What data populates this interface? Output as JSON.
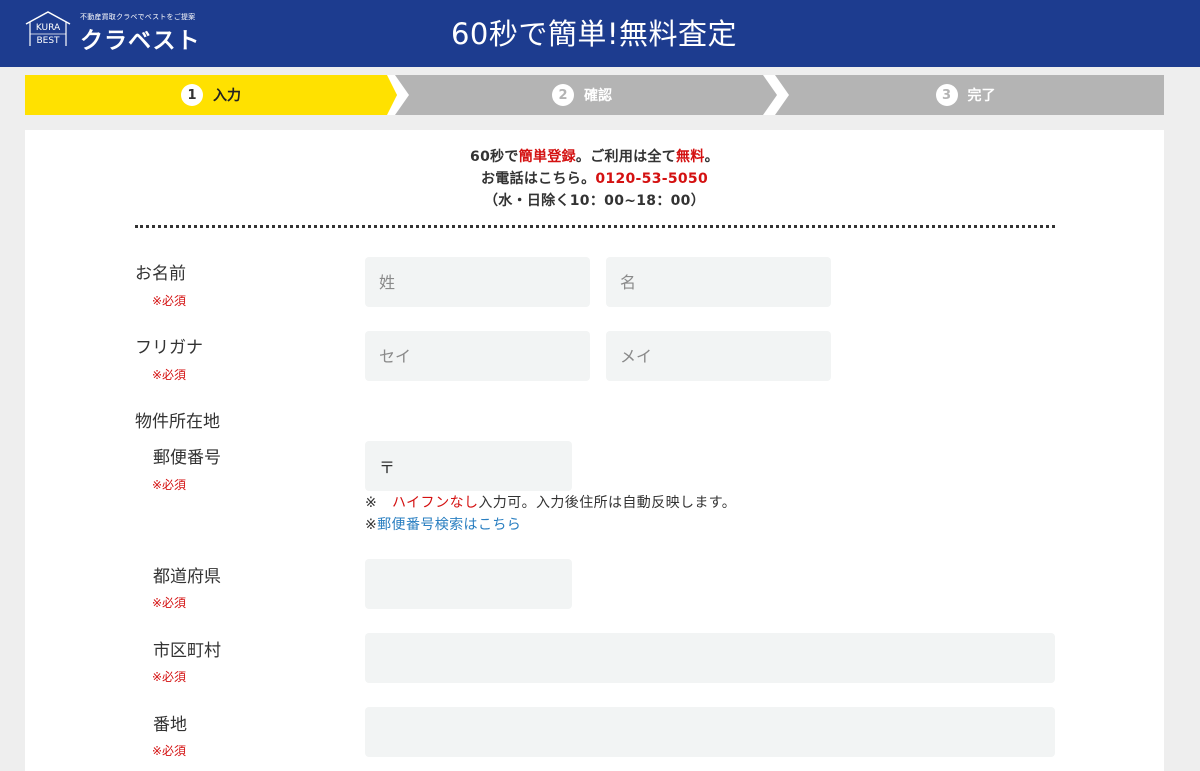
{
  "header": {
    "logo_tagline": "不動産買取クラベでベストをご提案",
    "logo_name": "クラベスト",
    "logo_kura": "KURA",
    "logo_best": "BEST",
    "title": "60秒で簡単!無料査定"
  },
  "steps": [
    {
      "num": "1",
      "label": "入力",
      "active": true
    },
    {
      "num": "2",
      "label": "確認",
      "active": false
    },
    {
      "num": "3",
      "label": "完了",
      "active": false
    }
  ],
  "intro": {
    "line1_a": "60秒で",
    "line1_b": "簡単登録",
    "line1_c": "。ご利用は全て",
    "line1_d": "無料",
    "line1_e": "。",
    "line2_a": "お電話はこちら。",
    "line2_phone": "0120-53-5050",
    "line3": "（水・日除く10：00~18：00）"
  },
  "form": {
    "required_label": "※必須",
    "name": {
      "label": "お名前",
      "last_placeholder": "姓",
      "first_placeholder": "名"
    },
    "furigana": {
      "label": "フリガナ",
      "last_placeholder": "セイ",
      "first_placeholder": "メイ"
    },
    "property_section": "物件所在地",
    "postal": {
      "label": "郵便番号",
      "value": "〒"
    },
    "postal_note_prefix": "※",
    "postal_note_red": "ハイフンなし",
    "postal_note_rest": "入力可。入力後住所は自動反映します。",
    "postal_link_prefix": "※",
    "postal_link": "郵便番号検索はこちら",
    "prefecture": {
      "label": "都道府県"
    },
    "city": {
      "label": "市区町村"
    },
    "address": {
      "label": "番地"
    }
  },
  "colors": {
    "header_bg": "#1d3c8f",
    "active_step": "#ffe100",
    "inactive_step": "#b4b4b4",
    "required_red": "#d41111",
    "link_blue": "#2a7fc1",
    "field_bg": "#f2f4f4"
  }
}
